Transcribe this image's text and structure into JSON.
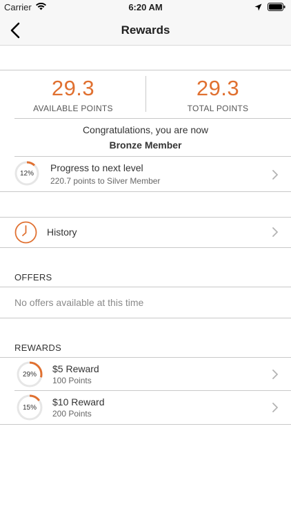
{
  "status": {
    "carrier": "Carrier",
    "time": "6:20 AM"
  },
  "nav": {
    "title": "Rewards"
  },
  "points": {
    "available_value": "29.3",
    "available_label": "AVAILABLE POINTS",
    "total_value": "29.3",
    "total_label": "TOTAL POINTS"
  },
  "membership": {
    "congrats": "Congratulations, you are now",
    "level": "Bronze Member"
  },
  "progress": {
    "percent_label": "12%",
    "percent": 12,
    "title": "Progress to next level",
    "subtitle": "220.7 points to Silver Member"
  },
  "history": {
    "label": "History"
  },
  "offers": {
    "header": "OFFERS",
    "empty": "No offers available at this time"
  },
  "rewards": {
    "header": "REWARDS",
    "items": [
      {
        "percent_label": "29%",
        "percent": 29,
        "title": "$5 Reward",
        "points": "100 Points"
      },
      {
        "percent_label": "15%",
        "percent": 15,
        "title": "$10 Reward",
        "points": "200 Points"
      }
    ]
  },
  "colors": {
    "accent": "#e07030",
    "ring_track": "#e6e6e6",
    "divider": "#c8c8c8"
  }
}
